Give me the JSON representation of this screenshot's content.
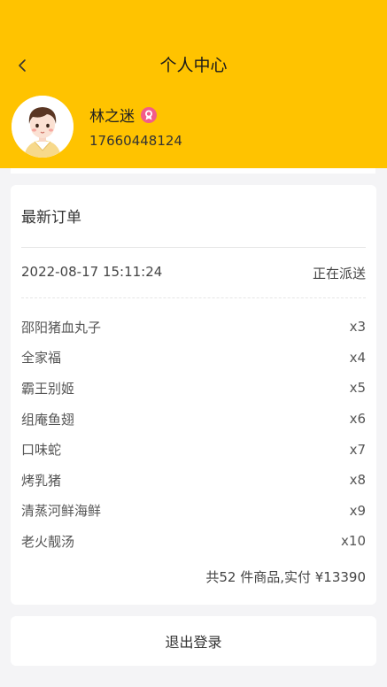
{
  "header": {
    "title": "个人中心",
    "background_color": "#ffc300"
  },
  "user": {
    "name": "林之迷",
    "phone": "17660448124",
    "avatar_icon": "avatar-illustration",
    "badge_icon": "award-badge-icon"
  },
  "order": {
    "section_title": "最新订单",
    "time": "2022-08-17 15:11:24",
    "status": "正在派送",
    "items": [
      {
        "name": "邵阳猪血丸子",
        "qty": "x3"
      },
      {
        "name": "全家福",
        "qty": "x4"
      },
      {
        "name": "霸王别姬",
        "qty": "x5"
      },
      {
        "name": "组庵鱼翅",
        "qty": "x6"
      },
      {
        "name": "口味蛇",
        "qty": "x7"
      },
      {
        "name": "烤乳猪",
        "qty": "x8"
      },
      {
        "name": "清蒸河鲜海鲜",
        "qty": "x9"
      },
      {
        "name": "老火靓汤",
        "qty": "x10"
      }
    ],
    "summary": "共52 件商品,实付 ¥13390"
  },
  "logout_label": "退出登录"
}
